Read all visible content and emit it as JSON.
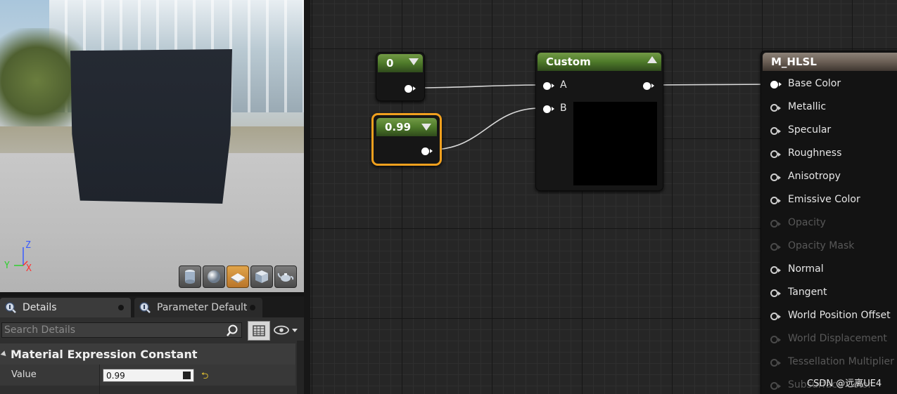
{
  "viewport": {
    "axis": {
      "z": "Z",
      "y": "Y",
      "x": "X"
    },
    "toolbar": [
      "cylinder-icon",
      "sphere-icon",
      "plane-icon",
      "cube-icon",
      "teapot-icon"
    ],
    "active_tool": "plane-icon"
  },
  "details": {
    "tabs": [
      {
        "label": "Details",
        "icon": "details-icon"
      },
      {
        "label": "Parameter Defaults",
        "icon": "parameter-icon"
      }
    ],
    "search_placeholder": "Search Details",
    "section_title": "Material Expression Constant",
    "property_label": "Value",
    "property_value": "0.99",
    "reset_glyph": "⮌"
  },
  "graph": {
    "nodes": {
      "const0": {
        "title": "0"
      },
      "const099": {
        "title": "0.99",
        "selected": true
      },
      "custom": {
        "title": "Custom",
        "inputs": [
          "A",
          "B"
        ]
      }
    },
    "material": {
      "title": "M_HLSL",
      "inputs": [
        {
          "label": "Base Color",
          "state": "connected"
        },
        {
          "label": "Metallic",
          "state": "enabled"
        },
        {
          "label": "Specular",
          "state": "enabled"
        },
        {
          "label": "Roughness",
          "state": "enabled"
        },
        {
          "label": "Anisotropy",
          "state": "enabled"
        },
        {
          "label": "Emissive Color",
          "state": "enabled"
        },
        {
          "label": "Opacity",
          "state": "disabled"
        },
        {
          "label": "Opacity Mask",
          "state": "disabled"
        },
        {
          "label": "Normal",
          "state": "enabled"
        },
        {
          "label": "Tangent",
          "state": "enabled"
        },
        {
          "label": "World Position Offset",
          "state": "enabled"
        },
        {
          "label": "World Displacement",
          "state": "disabled"
        },
        {
          "label": "Tessellation Multiplier",
          "state": "disabled"
        },
        {
          "label": "Subsurface Color",
          "state": "disabled"
        }
      ]
    },
    "watermark": "CSDN @远离UE4"
  },
  "colors": {
    "selection_outline": "#f0a01e",
    "constant_header": "#5a8a32",
    "material_header": "#6b5f55",
    "wire": "#d8d8d8"
  }
}
